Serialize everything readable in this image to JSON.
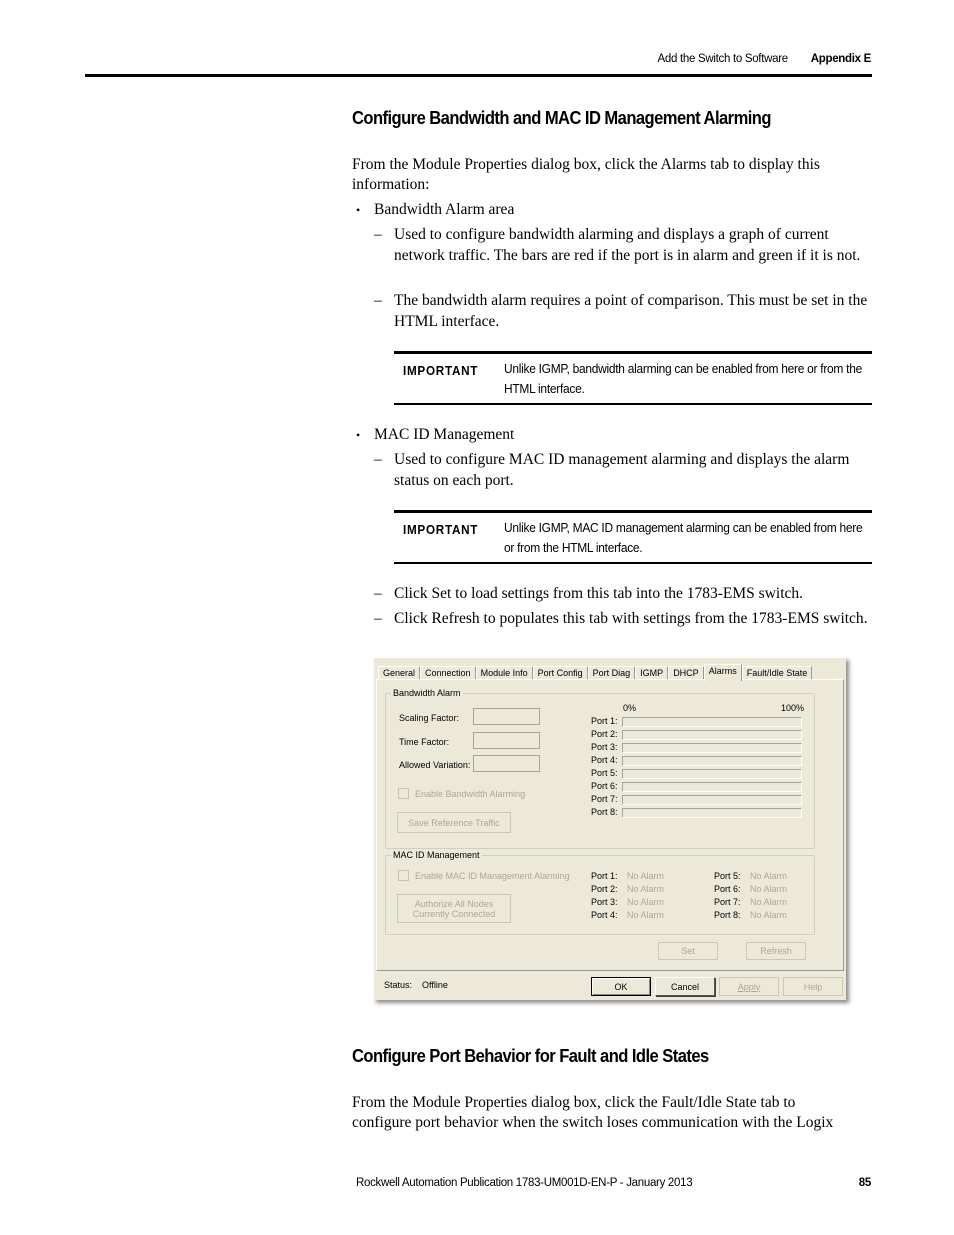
{
  "header": {
    "section": "Add the Switch to Software",
    "appendix": "Appendix E"
  },
  "section1": {
    "title": "Configure Bandwidth and MAC ID Management Alarming",
    "intro": "From the Module Properties dialog box, click the Alarms tab to display this information:",
    "bullets": [
      {
        "label": "Bandwidth Alarm area",
        "dashes": [
          "Used to configure bandwidth alarming and displays a graph of current network traffic. The bars are red if the port is in alarm and green if it is not.",
          "The bandwidth alarm requires a point of comparison. This must be set in the HTML interface."
        ],
        "important": {
          "tag": "IMPORTANT",
          "text": "Unlike IGMP, bandwidth alarming can be enabled from here or from the HTML interface."
        }
      },
      {
        "label": "MAC ID Management",
        "dashes": [
          "Used to configure MAC ID management alarming and displays the alarm status on each port."
        ],
        "important": {
          "tag": "IMPORTANT",
          "text": "Unlike IGMP, MAC ID management alarming can be enabled from here or from the HTML interface."
        }
      }
    ],
    "trailing_dashes": [
      "Click Set to load settings from this tab into the 1783-EMS switch.",
      "Click Refresh to populates this tab with settings from the 1783-EMS switch."
    ]
  },
  "dialog": {
    "tabs": [
      "General",
      "Connection",
      "Module Info",
      "Port Config",
      "Port Diag",
      "IGMP",
      "DHCP",
      "Alarms",
      "Fault/Idle State"
    ],
    "active_tab": "Alarms",
    "bandwidth": {
      "legend": "Bandwidth Alarm",
      "scaling_factor_label": "Scaling Factor:",
      "scaling_factor_value": "",
      "time_factor_label": "Time Factor:",
      "time_factor_value": "",
      "allowed_variation_label": "Allowed Variation:",
      "allowed_variation_value": "",
      "enable_label": "Enable Bandwidth Alarming",
      "enable_checked": false,
      "save_button": "Save Reference Traffic",
      "scale_min": "0%",
      "scale_max": "100%",
      "ports": [
        {
          "label": "Port 1:",
          "traffic_percent": 0
        },
        {
          "label": "Port 2:",
          "traffic_percent": 0
        },
        {
          "label": "Port 3:",
          "traffic_percent": 0
        },
        {
          "label": "Port 4:",
          "traffic_percent": 0
        },
        {
          "label": "Port 5:",
          "traffic_percent": 0
        },
        {
          "label": "Port 6:",
          "traffic_percent": 0
        },
        {
          "label": "Port 7:",
          "traffic_percent": 0
        },
        {
          "label": "Port 8:",
          "traffic_percent": 0
        }
      ]
    },
    "mac": {
      "legend": "MAC ID Management",
      "enable_label": "Enable MAC ID Management Alarming",
      "enable_checked": false,
      "authorize_button_line1": "Authorize All Nodes",
      "authorize_button_line2": "Currently Connected",
      "ports": [
        {
          "label": "Port 1:",
          "status": "No Alarm"
        },
        {
          "label": "Port 2:",
          "status": "No Alarm"
        },
        {
          "label": "Port 3:",
          "status": "No Alarm"
        },
        {
          "label": "Port 4:",
          "status": "No Alarm"
        },
        {
          "label": "Port 5:",
          "status": "No Alarm"
        },
        {
          "label": "Port 6:",
          "status": "No Alarm"
        },
        {
          "label": "Port 7:",
          "status": "No Alarm"
        },
        {
          "label": "Port 8:",
          "status": "No Alarm"
        }
      ]
    },
    "set_button": "Set",
    "refresh_button": "Refresh",
    "status_label": "Status:",
    "status_value": "Offline",
    "ok_button": "OK",
    "cancel_button": "Cancel",
    "apply_button": "Apply",
    "help_button": "Help"
  },
  "section2": {
    "title": "Configure Port Behavior for Fault and Idle States",
    "intro": "From the Module Properties dialog box, click the Fault/Idle State tab to configure port behavior when the switch loses communication with the Logix"
  },
  "footer": {
    "publication": "Rockwell Automation Publication 1783-UM001D-EN-P - January 2013",
    "page_number": "85"
  }
}
